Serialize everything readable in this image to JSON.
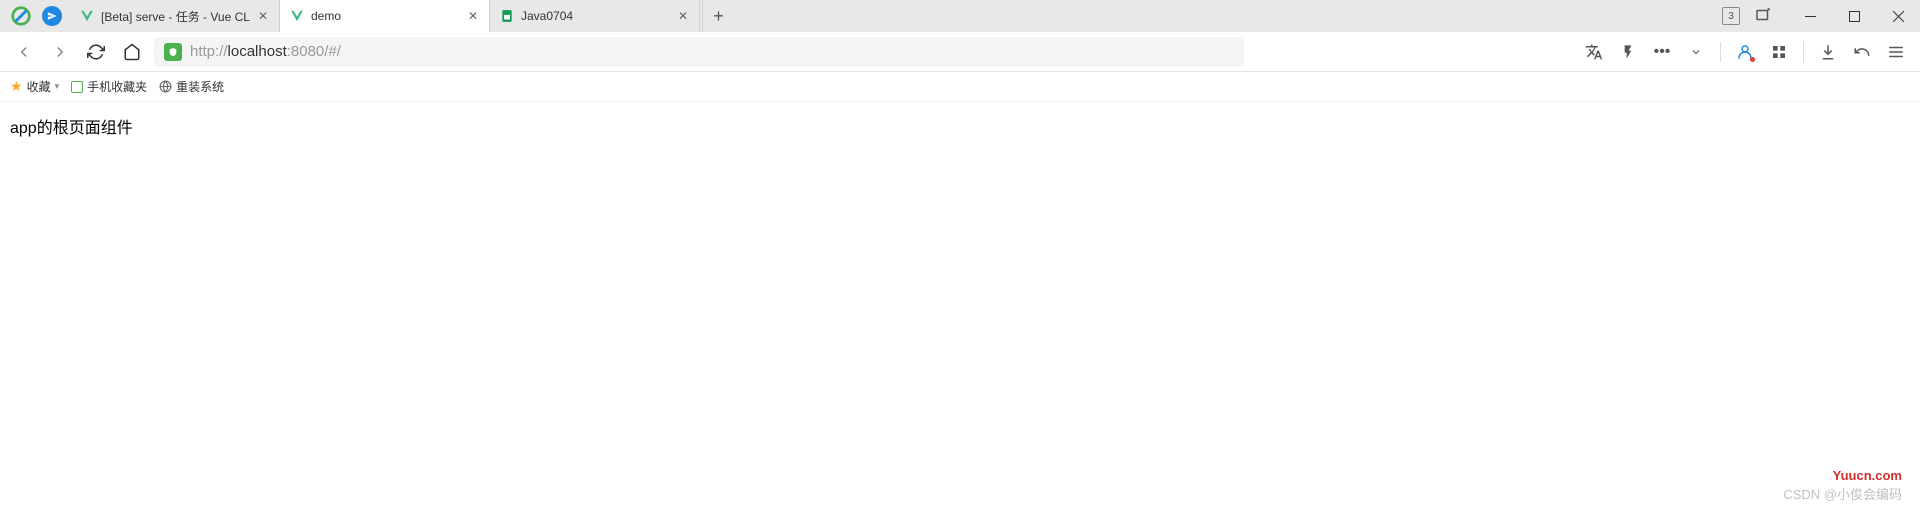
{
  "tabs": [
    {
      "title": "[Beta] serve - 任务 - Vue CL",
      "icon": "vue"
    },
    {
      "title": "demo",
      "icon": "vue",
      "active": true
    },
    {
      "title": "Java0704",
      "icon": "sheets"
    }
  ],
  "window": {
    "indicator": "3"
  },
  "url": {
    "protocol": "http://",
    "host": "localhost",
    "port": ":8080",
    "path": "/#/"
  },
  "bookmarks": {
    "favorites": "收藏",
    "mobile": "手机收藏夹",
    "reinstall": "重装系统"
  },
  "content": {
    "text": "app的根页面组件"
  },
  "watermarks": {
    "red": "Yuucn.com",
    "grey": "CSDN @小俊会编码"
  }
}
